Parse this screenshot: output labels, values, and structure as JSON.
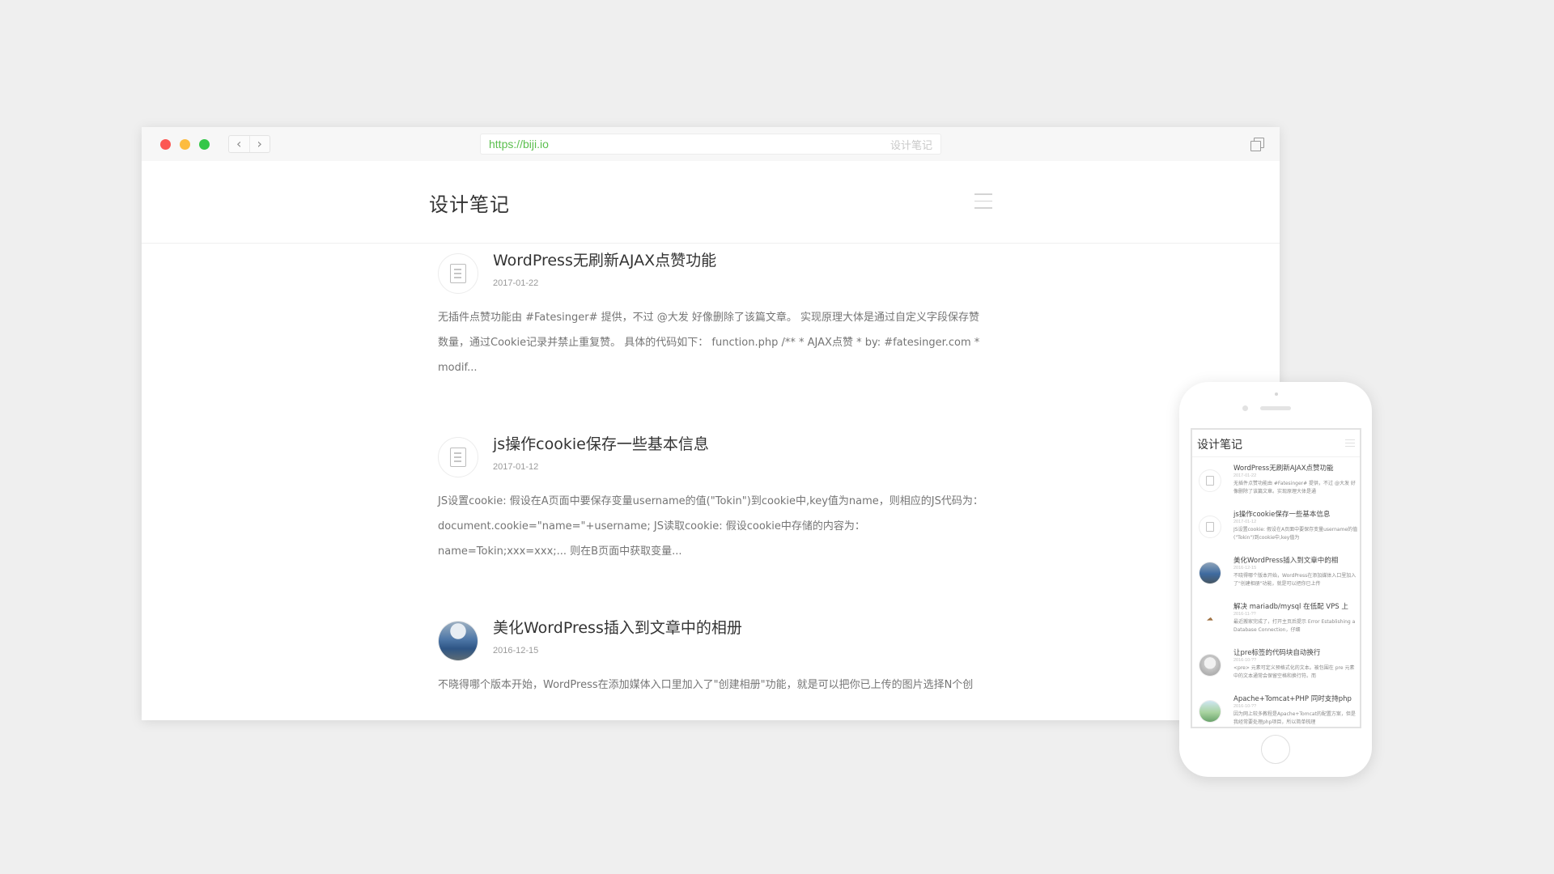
{
  "browser": {
    "url": "https://biji.io",
    "title": "设计笔记",
    "back_glyph": "‹",
    "forward_glyph": "›",
    "traffic_lights": [
      "#fc5753",
      "#fdbc40",
      "#33c748"
    ]
  },
  "site": {
    "title": "设计笔记",
    "menu_icon": "hamburger-icon"
  },
  "posts": [
    {
      "title": "WordPress无刷新AJAX点赞功能",
      "date": "2017-01-22",
      "icon": "document-icon",
      "excerpt": "无插件点赞功能由 #Fatesinger# 提供，不过 @大发 好像删除了该篇文章。 实现原理大体是通过自定义字段保存赞数量，通过Cookie记录并禁止重复赞。 具体的代码如下： function.php /** * AJAX点赞 * by: #fatesinger.com * modif..."
    },
    {
      "title": "js操作cookie保存一些基本信息",
      "date": "2017-01-12",
      "icon": "document-icon",
      "excerpt": "JS设置cookie: 假设在A页面中要保存变量username的值(\"Tokin\")到cookie中,key值为name，则相应的JS代码为：document.cookie=\"name=\"+username; JS读取cookie: 假设cookie中存储的内容为：name=Tokin;xxx=xxx;... 则在B页面中获取变量..."
    },
    {
      "title": "美化WordPress插入到文章中的相册",
      "date": "2016-12-15",
      "icon": "photo-thumbnail",
      "excerpt": "不晓得哪个版本开始，WordPress在添加媒体入口里加入了\"创建相册\"功能，就是可以把你已上传的图片选择N个创"
    }
  ],
  "mobile": {
    "site_title": "设计笔记",
    "posts": [
      {
        "title": "WordPress无刷新AJAX点赞功能",
        "date": "2017-01-22",
        "excerpt": "无插件点赞功能由 #Fatesinger# 提供，不过 @大发 好像删除了该篇文章。实现原理大体是通"
      },
      {
        "title": "js操作cookie保存一些基本信息",
        "date": "2017-01-12",
        "excerpt": "JS设置cookie: 假设在A页面中要保存变量username的值(\"Tokin\")到cookie中,key值为"
      },
      {
        "title": "美化WordPress插入到文章中的相",
        "date": "2016-12-15",
        "excerpt": "不晓得哪个版本开始，WordPress在添加媒体入口里加入了\"创建相册\"功能，就是可以把你已上传"
      },
      {
        "title": "解决 mariadb/mysql 在低配 VPS 上",
        "date": "2016-11-??",
        "excerpt": "最近搬家完成了，打开主页后提示 Error Establishing a Database Connection，仔细"
      },
      {
        "title": "让pre标签的代码块自动换行",
        "date": "2016-10-??",
        "excerpt": "<pre> 元素可定义预格式化的文本。被包围在 pre 元素中的文本通常会保留空格和换行符。而"
      },
      {
        "title": "Apache+Tomcat+PHP 同时支持php",
        "date": "2016-10-??",
        "excerpt": "因为网上较多教程是Apache+Tomcat的配置方案，但是我经常要处理php项目，所以简单梳理"
      }
    ]
  }
}
